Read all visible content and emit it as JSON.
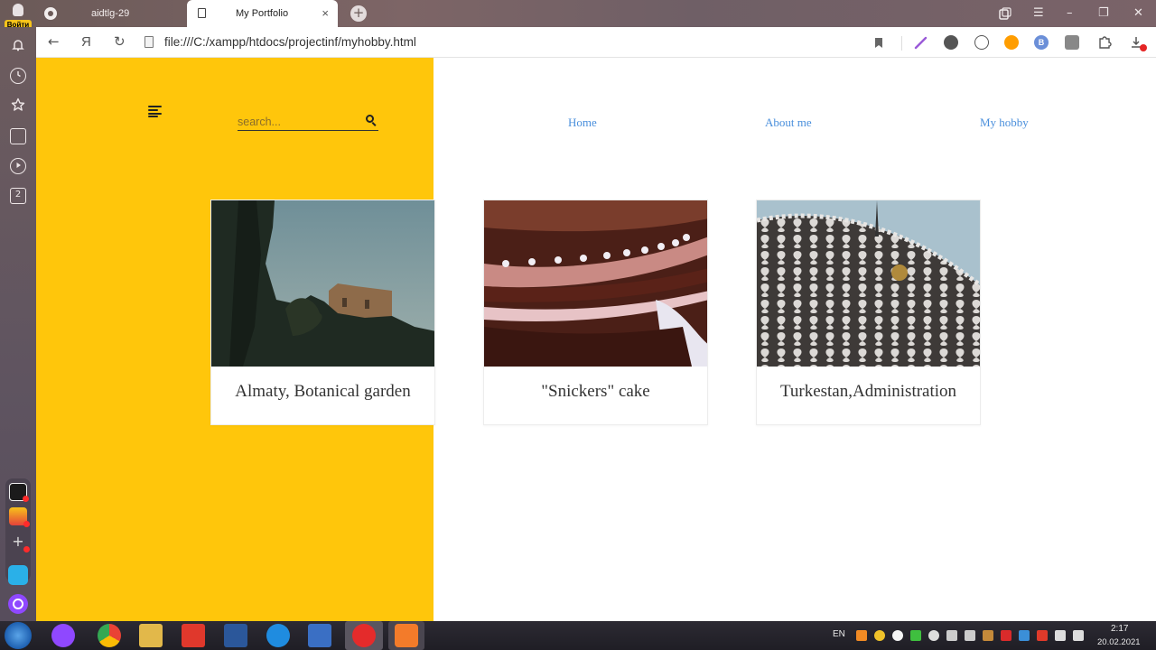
{
  "browser": {
    "profile_label": "Войти",
    "tabs": [
      {
        "label": "aidtlg-29",
        "icon": "github-icon",
        "active": false
      },
      {
        "label": "My Portfolio",
        "icon": "document-icon",
        "active": true
      }
    ],
    "close_glyph": "×",
    "newtab_glyph": "+",
    "window_controls": {
      "minimize": "–",
      "maximize": "❐",
      "close": "✕",
      "menu": "☰"
    },
    "url": "file:///C:/xampp/htdocs/projectinf/myhobby.html",
    "nav": {
      "back": "←",
      "yandex": "Я",
      "reload": "↻"
    },
    "sidebar_badge": "2",
    "extension_letter": "B"
  },
  "page": {
    "search_placeholder": "search...",
    "nav_links": [
      "Home",
      "About me",
      "My hobby"
    ],
    "cards": [
      {
        "caption": "Almaty, Botanical garden"
      },
      {
        "caption": "\"Snickers\" cake"
      },
      {
        "caption": "Turkestan,Administration"
      }
    ],
    "colors": {
      "accent_yellow": "#ffc60b",
      "link_blue": "#4a8fdc"
    }
  },
  "taskbar": {
    "language": "EN",
    "time": "2:17",
    "date": "20.02.2021"
  }
}
